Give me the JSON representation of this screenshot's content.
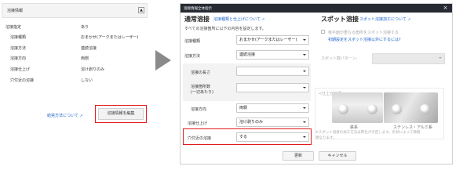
{
  "left_panel": {
    "title": "溶接情報",
    "collapse_icon": "▲",
    "rows": [
      {
        "label": "溶接指定",
        "value": "あり"
      },
      {
        "label": "溶接種類",
        "value": "おまかせ(アークまたはレーザー)"
      },
      {
        "label": "溶接方法",
        "value": "連続溶接"
      },
      {
        "label": "溶接方向",
        "value": "両側"
      },
      {
        "label": "溶接仕上げ",
        "value": "溶け剥りのみ"
      },
      {
        "label": "穴付近の溶接",
        "value": "しない"
      }
    ],
    "link_label": "結晃方法について",
    "edit_button": "溶接情報を編集"
  },
  "modal": {
    "title": "溶接情報全体指示",
    "close_icon": "×",
    "welding": {
      "section_title": "通常溶接",
      "link": "溶接種類と仕上げについて",
      "note": "すべての溶接箇所に以下の内容を設定します。",
      "fields": [
        {
          "label": "溶接種類",
          "value": "おまかせ(アークまたはレーザー)"
        },
        {
          "label": "溶接方法",
          "value": "連続溶接"
        },
        {
          "label": "溶接の長さ",
          "value": ""
        },
        {
          "label": "溶接箇所数",
          "sublabel": "(一辺あたり)",
          "value": ""
        },
        {
          "label": "溶接方向",
          "value": "両側"
        },
        {
          "label": "溶接仕上げ",
          "value": "溶け剥りのみ"
        },
        {
          "label": "穴付近の溶接",
          "value": "する"
        }
      ]
    },
    "spot": {
      "section_title": "スポット溶接",
      "link": "スポット溶接加工について",
      "checkbox_label": "板平面が重なる箇所をスポット溶接する",
      "sub_link": "初期設定をスポット溶接以外にするには?",
      "pattern_label": "スポット数パターン:",
      "pattern_value": "",
      "example_label": "<仕上がり例>",
      "example_captions": [
        "鉄系",
        "ステンレス・アルミ系"
      ],
      "disclaimer_line1": "※スポット溶接の加工方法は弊社が決定します。形状によって跡痕",
      "disclaimer_line2": "異なります。"
    },
    "buttons": {
      "update": "更新",
      "cancel": "キャンセル"
    }
  },
  "colors": {
    "header_bg": "#262a33",
    "link": "#1a62c9",
    "highlight": "#e21b1b"
  },
  "icons": [
    "chevron-up-icon",
    "external-link-icon",
    "close-icon",
    "right-arrow-icon",
    "chevron-down-icon",
    "checkbox-icon"
  ]
}
